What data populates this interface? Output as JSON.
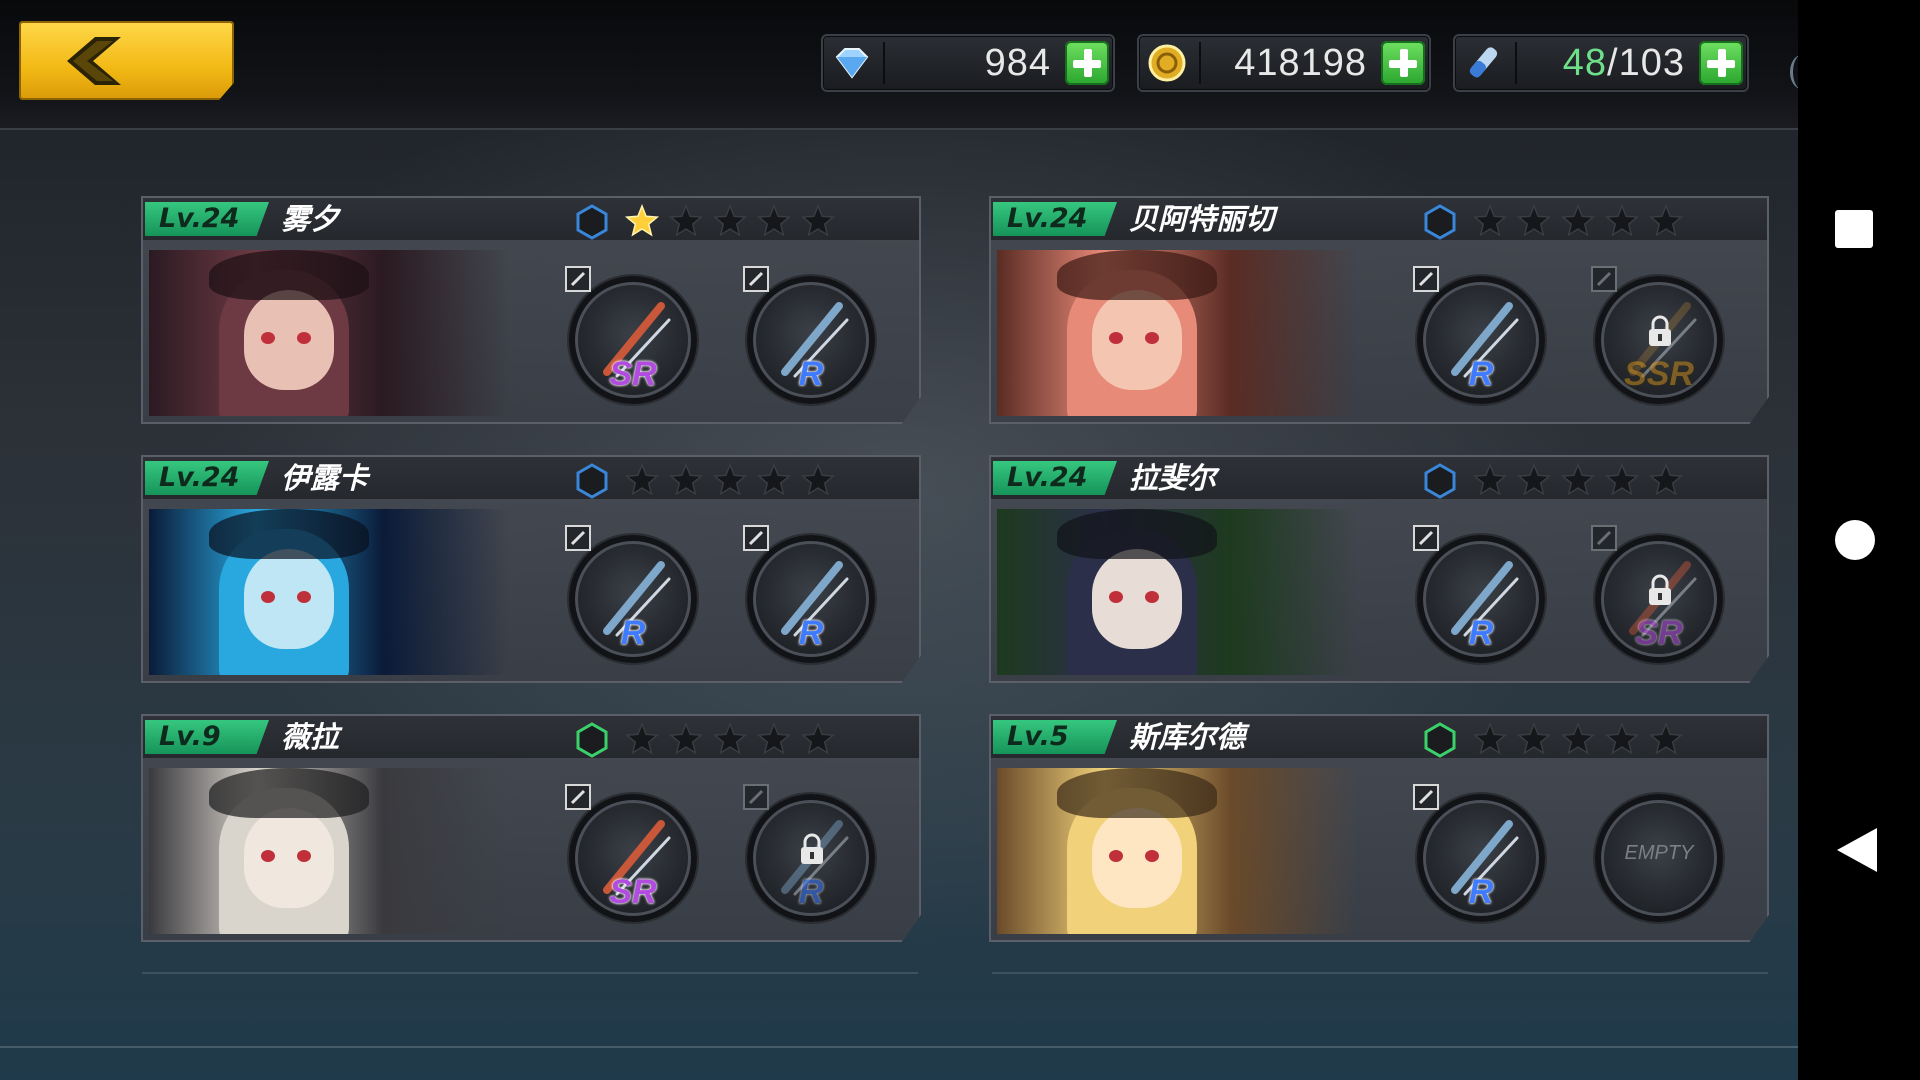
{
  "topbar": {
    "back_icon": "back-arrow-icon",
    "resources": [
      {
        "icon": "diamond-icon",
        "value": "984"
      },
      {
        "icon": "gold-coin-icon",
        "value": "418198"
      },
      {
        "icon": "stamina-potion-icon",
        "current": "48",
        "sep": "/",
        "max": "103"
      }
    ]
  },
  "characters": [
    {
      "level": "Lv.24",
      "name": "雾夕",
      "stars": 1,
      "hex_color": "#3a86d8",
      "weapons": [
        {
          "rarity": "SR",
          "locked": false
        },
        {
          "rarity": "R",
          "locked": false
        }
      ]
    },
    {
      "level": "Lv.24",
      "name": "贝阿特丽切",
      "stars": 0,
      "hex_color": "#3a86d8",
      "weapons": [
        {
          "rarity": "R",
          "locked": false
        },
        {
          "rarity": "SSR",
          "locked": true
        }
      ]
    },
    {
      "level": "Lv.24",
      "name": "伊露卡",
      "stars": 0,
      "hex_color": "#3a86d8",
      "weapons": [
        {
          "rarity": "R",
          "locked": false
        },
        {
          "rarity": "R",
          "locked": false
        }
      ]
    },
    {
      "level": "Lv.24",
      "name": "拉斐尔",
      "stars": 0,
      "hex_color": "#3a86d8",
      "weapons": [
        {
          "rarity": "R",
          "locked": false
        },
        {
          "rarity": "SR",
          "locked": true
        }
      ]
    },
    {
      "level": "Lv.9",
      "name": "薇拉",
      "stars": 0,
      "hex_color": "#3bd16a",
      "weapons": [
        {
          "rarity": "SR",
          "locked": false
        },
        {
          "rarity": "R",
          "locked": true
        }
      ]
    },
    {
      "level": "Lv.5",
      "name": "斯库尔德",
      "stars": 0,
      "hex_color": "#3bd16a",
      "weapons": [
        {
          "rarity": "R",
          "locked": false
        },
        {
          "empty": true,
          "label": "EMPTY"
        }
      ]
    }
  ],
  "navbar": {
    "icons": [
      "recent-apps-icon",
      "home-icon",
      "back-icon"
    ]
  },
  "colors": {
    "accent_green": "#2bb56b",
    "gold": "#f2b915",
    "star_active": "#ffcf3a",
    "star_inactive": "#15171a"
  }
}
